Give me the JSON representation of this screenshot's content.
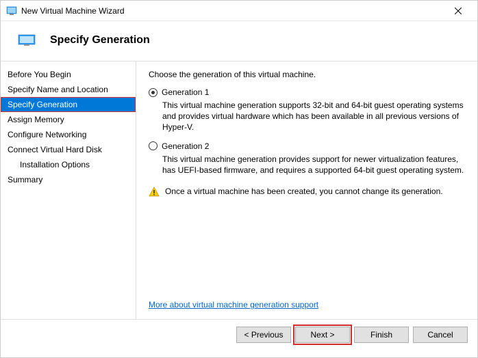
{
  "titlebar": {
    "title": "New Virtual Machine Wizard"
  },
  "header": {
    "title": "Specify Generation"
  },
  "sidebar": {
    "items": [
      {
        "label": "Before You Begin",
        "selected": false,
        "indent": false
      },
      {
        "label": "Specify Name and Location",
        "selected": false,
        "indent": false
      },
      {
        "label": "Specify Generation",
        "selected": true,
        "indent": false
      },
      {
        "label": "Assign Memory",
        "selected": false,
        "indent": false
      },
      {
        "label": "Configure Networking",
        "selected": false,
        "indent": false
      },
      {
        "label": "Connect Virtual Hard Disk",
        "selected": false,
        "indent": false
      },
      {
        "label": "Installation Options",
        "selected": false,
        "indent": true
      },
      {
        "label": "Summary",
        "selected": false,
        "indent": false
      }
    ]
  },
  "content": {
    "instruction": "Choose the generation of this virtual machine.",
    "options": [
      {
        "label": "Generation 1",
        "checked": true,
        "description": "This virtual machine generation supports 32-bit and 64-bit guest operating systems and provides virtual hardware which has been available in all previous versions of Hyper-V."
      },
      {
        "label": "Generation 2",
        "checked": false,
        "description": "This virtual machine generation provides support for newer virtualization features, has UEFI-based firmware, and requires a supported 64-bit guest operating system."
      }
    ],
    "warning": "Once a virtual machine has been created, you cannot change its generation.",
    "more_link": "More about virtual machine generation support"
  },
  "footer": {
    "previous": "< Previous",
    "next": "Next >",
    "finish": "Finish",
    "cancel": "Cancel"
  }
}
